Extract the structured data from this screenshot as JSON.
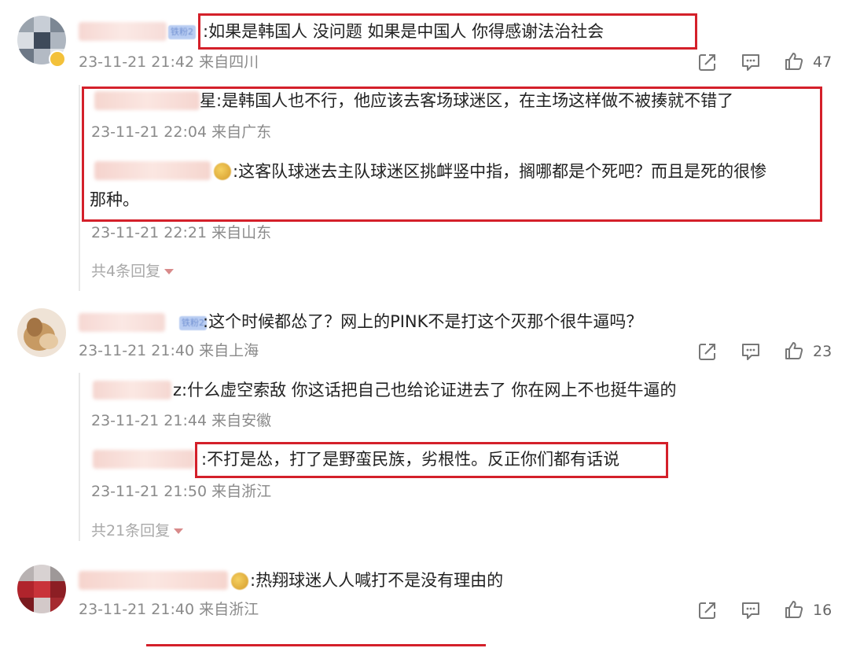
{
  "comments": [
    {
      "text": ":如果是韩国人  没问题    如果是中国人  你得感谢法治社会",
      "meta": "23-11-21 21:42 来自四川",
      "likes": "47",
      "badge": "铁粉2",
      "replies": [
        {
          "text": "星:是韩国人也不行，他应该去客场球迷区，在主场这样做不被揍就不错了",
          "meta": "23-11-21 22:04 来自广东"
        },
        {
          "text_line1": ":这客队球迷去主队球迷区挑衅竖中指，搁哪都是个死吧？而且是死的很惨",
          "text_line2": "那种。",
          "meta": "23-11-21 22:21 来自山东"
        }
      ],
      "more": "共4条回复"
    },
    {
      "text": ":这个时候都怂了？网上的PINK不是打这个灭那个很牛逼吗？",
      "meta": "23-11-21 21:40 来自上海",
      "likes": "23",
      "badge": "铁粉2",
      "replies": [
        {
          "text": "z:什么虚空索敌 你这话把自己也给论证进去了 你在网上不也挺牛逼的",
          "meta": "23-11-21 21:44 来自安徽"
        },
        {
          "text": ":不打是怂，打了是野蛮民族，劣根性。反正你们都有话说",
          "meta": "23-11-21 21:50 来自浙江"
        }
      ],
      "more": "共21条回复"
    },
    {
      "text": ":热翔球迷人人喊打不是没有理由的",
      "meta": "23-11-21 21:40 来自浙江",
      "likes": "16"
    }
  ],
  "icons": {
    "share": "share-icon",
    "comment": "comment-icon",
    "like": "thumbs-up-icon"
  },
  "colors": {
    "highlight_box": "#d4202a",
    "meta_text": "#8a8a8a",
    "reply_more": "#a9a9a9"
  }
}
